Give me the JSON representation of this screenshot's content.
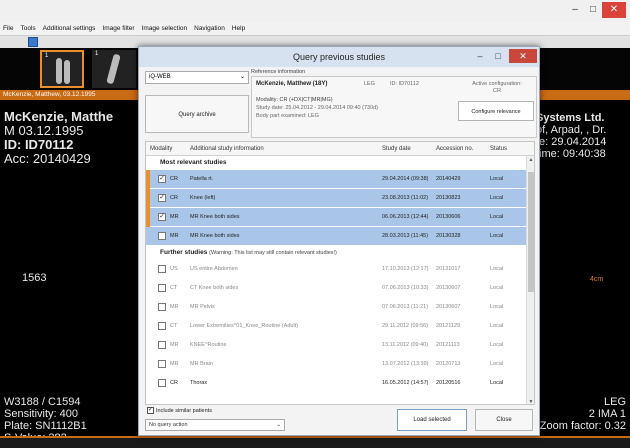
{
  "window": {
    "minimize": "–",
    "maximize": "□",
    "close": "✕"
  },
  "menu": [
    "File",
    "Tools",
    "Additional settings",
    "Image filter",
    "Image selection",
    "Navigation",
    "Help"
  ],
  "thumbnails": [
    {
      "number": "1"
    },
    {
      "number": "1"
    }
  ],
  "patient_strip": "McKenzie, Matthew, 03.12.1995",
  "overlay": {
    "left_top": [
      "McKenzie, Matthe",
      "M 03.12.1995",
      "ID: ID70112",
      "Acc: 20140429"
    ],
    "right_top": [
      "Systems Ltd.",
      "of, Arpad, , Dr.",
      "te: 29.04.2014",
      "time: 09:40:38"
    ],
    "mid_left": "1563",
    "mid_right": "4cm",
    "bottom_left": [
      "W3188 / C1594",
      "Sensitivity: 400",
      "Plate: SN1112B1",
      "S-Value: 282"
    ],
    "bottom_right": [
      "LEG",
      "",
      "2 IMA 1",
      "Zoom factor: 0.32"
    ]
  },
  "dialog": {
    "title": "Query previous studies",
    "archive_select": "iQ-WEB",
    "query_archive_button": "Query archive",
    "reference": {
      "label": "Reference information",
      "name": "McKenzie, Matthew (18Y)",
      "gender": "LEG",
      "id": "ID: ID70112",
      "modality": "Modality: CR (+DX|CT|MR|MG)",
      "study_date": "Study date: 25.04.2012 - 29.04.2014 09:40 (730d)",
      "body_part": "Body part examined: LEG"
    },
    "active_config": [
      "Active configuration:",
      "CR"
    ],
    "configure_button": "Configure relevance",
    "columns": [
      "Modality",
      "Additional study information",
      "Study date",
      "Accession no.",
      "Status"
    ],
    "groups": [
      {
        "title": "Most relevant studies",
        "note": "",
        "rows": [
          {
            "checked": "✓",
            "modality": "CR",
            "info": "Patella rt.",
            "date": "29.04.2014 (09:38)",
            "accession": "20140429",
            "status": "Local"
          },
          {
            "checked": "✓",
            "modality": "CR",
            "info": "Knee (left)",
            "date": "23.08.2013 (11:02)",
            "accession": "20130823",
            "status": "Local"
          },
          {
            "checked": "✓",
            "modality": "MR",
            "info": "MR Knee both sides",
            "date": "06.06.2013 (12:44)",
            "accession": "20130606",
            "status": "Local"
          },
          {
            "checked": "",
            "modality": "MR",
            "info": "MR Knee both sides",
            "date": "28.03.2013 (11:45)",
            "accession": "20130328",
            "status": "Local"
          }
        ]
      },
      {
        "title": "Further studies",
        "note": "(Warning: This list may still contain relevant studies!)",
        "rows": [
          {
            "checked": "",
            "modality": "US",
            "info": "US entire Abdomen",
            "date": "17.10.2013 (12:17)",
            "accession": "20131017",
            "status": "Local"
          },
          {
            "checked": "",
            "modality": "CT",
            "info": "CT Knee both sides",
            "date": "07.06.2013 (10:33)",
            "accession": "20130607",
            "status": "Local"
          },
          {
            "checked": "",
            "modality": "MR",
            "info": "MR Pelvis",
            "date": "07.06.2013 (11:21)",
            "accession": "20130607",
            "status": "Local"
          },
          {
            "checked": "",
            "modality": "CT",
            "info": "Lower Extremities^01_Knee_Routine (Adult)",
            "date": "29.11.2012 (09:56)",
            "accession": "20121129",
            "status": "Local"
          },
          {
            "checked": "",
            "modality": "MR",
            "info": "KNEE^Routine",
            "date": "13.11.2012 (09:40)",
            "accession": "20121113",
            "status": "Local"
          },
          {
            "checked": "",
            "modality": "MR",
            "info": "MR Brain",
            "date": "13.07.2012 (13:39)",
            "accession": "20120713",
            "status": "Local"
          },
          {
            "checked": "",
            "modality": "CR",
            "info": "Thorax",
            "date": "16.05.2012 (14:57)",
            "accession": "20120516",
            "status": "Local"
          }
        ]
      }
    ],
    "include_similar": "Include similar patients",
    "query_action": "No query action",
    "load_button": "Load selected",
    "close_button": "Close"
  }
}
